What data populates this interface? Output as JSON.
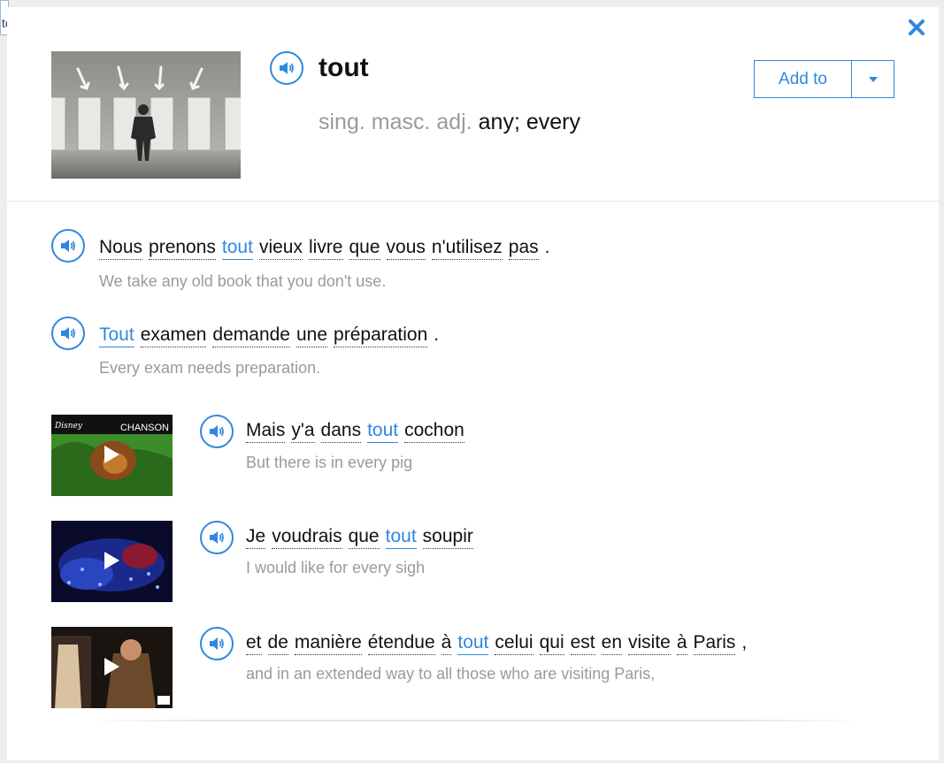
{
  "word": {
    "headword": "tout",
    "pos": "sing. masc. adj.",
    "definition": "any; every"
  },
  "buttons": {
    "add_to": "Add to"
  },
  "icons": {
    "close": "close-icon",
    "speaker": "speaker-icon",
    "caret": "caret-down-icon",
    "play": "play-icon"
  },
  "colors": {
    "accent": "#2f88e0",
    "muted": "#9a9a9a",
    "text": "#111111"
  },
  "examples": [
    {
      "fr": [
        {
          "t": "Nous"
        },
        {
          "t": "prenons"
        },
        {
          "t": "tout",
          "hl": true
        },
        {
          "t": "vieux"
        },
        {
          "t": "livre"
        },
        {
          "t": "que"
        },
        {
          "t": "vous"
        },
        {
          "t": "n'utilisez"
        },
        {
          "t": "pas"
        },
        {
          "t": ".",
          "p": true
        }
      ],
      "en": "We take any old book that you don't use."
    },
    {
      "fr": [
        {
          "t": "Tout",
          "hl": true
        },
        {
          "t": "examen"
        },
        {
          "t": "demande"
        },
        {
          "t": "une"
        },
        {
          "t": "préparation"
        },
        {
          "t": ".",
          "p": true
        }
      ],
      "en": "Every exam needs preparation."
    },
    {
      "fr": [
        {
          "t": "Mais"
        },
        {
          "t": "y'a"
        },
        {
          "t": "dans"
        },
        {
          "t": "tout",
          "hl": true
        },
        {
          "t": "cochon"
        }
      ],
      "en": "But there is in every pig",
      "video_label": "CHANSON"
    },
    {
      "fr": [
        {
          "t": "Je"
        },
        {
          "t": "voudrais"
        },
        {
          "t": "que"
        },
        {
          "t": "tout",
          "hl": true
        },
        {
          "t": "soupir"
        }
      ],
      "en": "I would like for every sigh"
    },
    {
      "fr": [
        {
          "t": "et"
        },
        {
          "t": "de"
        },
        {
          "t": "manière"
        },
        {
          "t": "étendue"
        },
        {
          "t": "à"
        },
        {
          "t": "tout",
          "hl": true
        },
        {
          "t": "celui"
        },
        {
          "t": "qui"
        },
        {
          "t": "est"
        },
        {
          "t": "en"
        },
        {
          "t": "visite"
        },
        {
          "t": "à"
        },
        {
          "t": "Paris"
        },
        {
          "t": ",",
          "p": true
        }
      ],
      "en": "and in an extended way to all those who are visiting Paris,"
    }
  ],
  "background": {
    "partial_text": "to"
  }
}
